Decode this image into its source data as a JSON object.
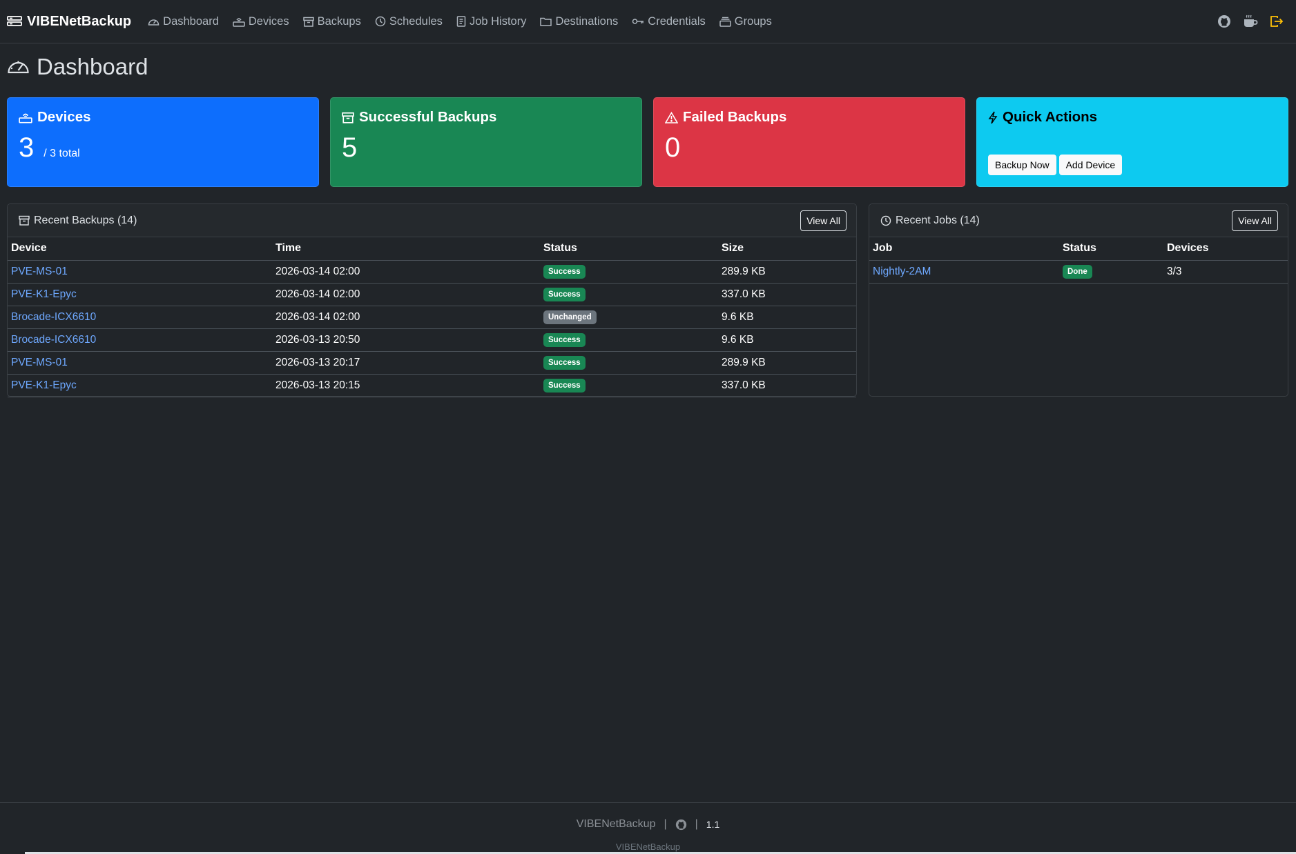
{
  "brand": "VIBENetBackup",
  "nav": [
    {
      "label": "Dashboard"
    },
    {
      "label": "Devices"
    },
    {
      "label": "Backups"
    },
    {
      "label": "Schedules"
    },
    {
      "label": "Job History"
    },
    {
      "label": "Destinations"
    },
    {
      "label": "Credentials"
    },
    {
      "label": "Groups"
    }
  ],
  "page_title": "Dashboard",
  "cards": {
    "devices": {
      "title": "Devices",
      "value": "3",
      "sub": "/ 3 total"
    },
    "successful": {
      "title": "Successful Backups",
      "value": "5"
    },
    "failed": {
      "title": "Failed Backups",
      "value": "0"
    },
    "quick_actions": {
      "title": "Quick Actions",
      "backup_now": "Backup Now",
      "add_device": "Add Device"
    }
  },
  "recent_backups": {
    "title": "Recent Backups (14)",
    "view_all": "View All",
    "columns": [
      "Device",
      "Time",
      "Status",
      "Size"
    ],
    "rows": [
      {
        "device": "PVE-MS-01",
        "time": "2026-03-14 02:00",
        "status": "Success",
        "size": "289.9 KB"
      },
      {
        "device": "PVE-K1-Epyc",
        "time": "2026-03-14 02:00",
        "status": "Success",
        "size": "337.0 KB"
      },
      {
        "device": "Brocade-ICX6610",
        "time": "2026-03-14 02:00",
        "status": "Unchanged",
        "size": "9.6 KB"
      },
      {
        "device": "Brocade-ICX6610",
        "time": "2026-03-13 20:50",
        "status": "Success",
        "size": "9.6 KB"
      },
      {
        "device": "PVE-MS-01",
        "time": "2026-03-13 20:17",
        "status": "Success",
        "size": "289.9 KB"
      },
      {
        "device": "PVE-K1-Epyc",
        "time": "2026-03-13 20:15",
        "status": "Success",
        "size": "337.0 KB"
      }
    ]
  },
  "recent_jobs": {
    "title": "Recent Jobs (14)",
    "view_all": "View All",
    "columns": [
      "Job",
      "Status",
      "Devices"
    ],
    "rows": [
      {
        "job": "Nightly-2AM",
        "status": "Done",
        "devices": "3/3"
      }
    ]
  },
  "footer": {
    "name": "VIBENetBackup",
    "sep": "|",
    "version": "1.1",
    "sub": "VIBENetBackup"
  },
  "colors": {
    "primary": "#0d6efd",
    "success": "#198754",
    "danger": "#dc3545",
    "info": "#0dcaf0",
    "secondary": "#6c757d",
    "warning": "#ffc107",
    "link": "#6ea8fe"
  }
}
